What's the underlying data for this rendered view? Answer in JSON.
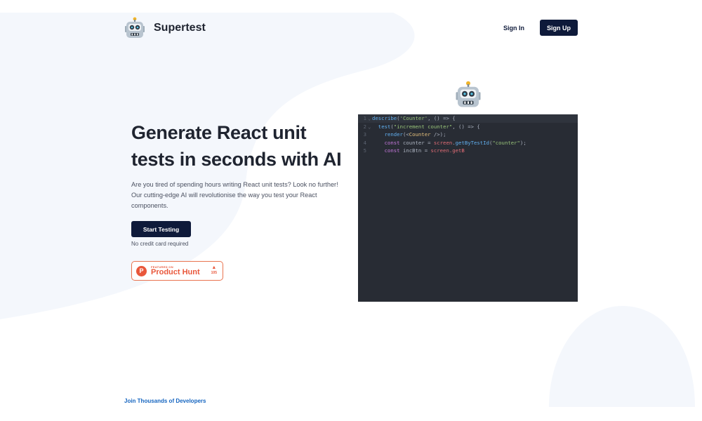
{
  "header": {
    "brand_name": "Supertest",
    "sign_in_label": "Sign In",
    "sign_up_label": "Sign Up"
  },
  "hero": {
    "title_line1": "Generate React unit",
    "title_line2": "tests in seconds with AI",
    "description": "Are you tired of spending hours writing React unit tests? Look no further! Our cutting-edge AI will revolutionise the way you test your React components.",
    "cta_label": "Start Testing",
    "cta_note": "No credit card required"
  },
  "product_hunt": {
    "featured_label": "FEATURED ON",
    "name": "Product Hunt",
    "votes": "105"
  },
  "editor": {
    "lines": [
      {
        "n": "1",
        "fold": "⌄"
      },
      {
        "n": "2",
        "fold": "⌄"
      },
      {
        "n": "3",
        "fold": ""
      },
      {
        "n": "4",
        "fold": ""
      },
      {
        "n": "5",
        "fold": ""
      }
    ]
  },
  "footer": {
    "join_label": "Join Thousands of Developers"
  },
  "colors": {
    "primary": "#0e1a3a",
    "product_hunt": "#e9573b",
    "link": "#1565c0",
    "editor_bg": "#282c34"
  }
}
